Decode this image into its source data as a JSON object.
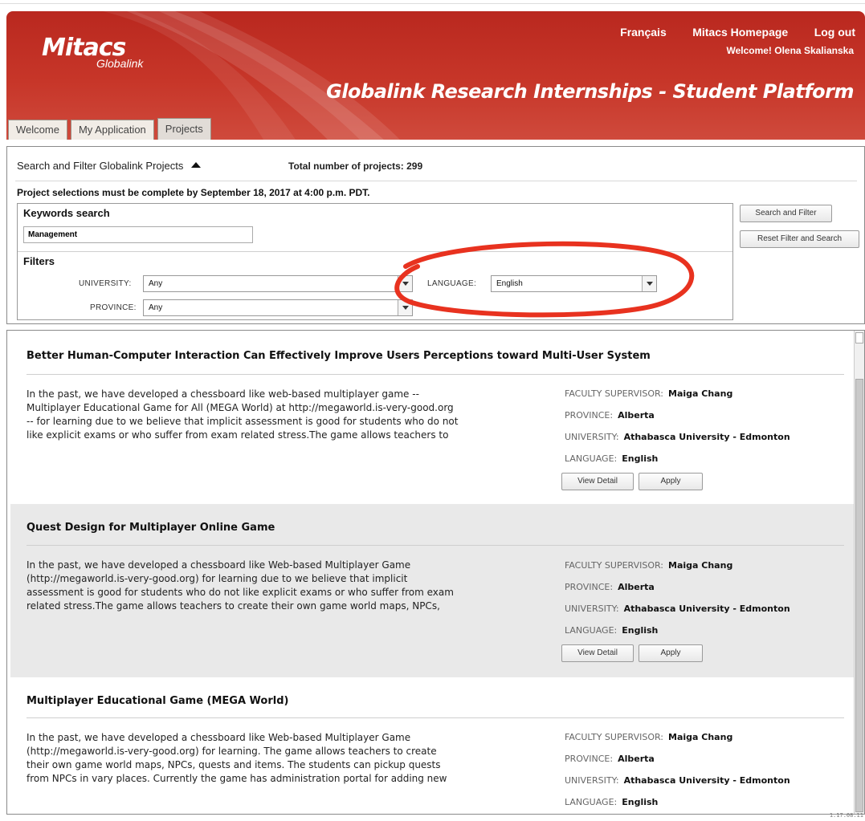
{
  "header": {
    "logo_main": "Mitacs",
    "logo_sub": "Globalink",
    "links": [
      "Français",
      "Mitacs Homepage",
      "Log out"
    ],
    "welcome": "Welcome! Olena Skalianska",
    "platform_title": "Globalink Research Internships - Student Platform",
    "tabs": [
      "Welcome",
      "My Application",
      "Projects"
    ],
    "active_tab": "Projects",
    "brand_color": "#c0302a"
  },
  "search": {
    "heading": "Search and Filter Globalink Projects",
    "total": "Total number of projects: 299",
    "deadline": "Project selections must be complete by September 18, 2017 at 4:00 p.m. PDT.",
    "keywords_label": "Keywords search",
    "keywords_value": "Management",
    "filters_label": "Filters",
    "university_label": "UNIVERSITY:",
    "university_value": "Any",
    "province_label": "PROVINCE:",
    "province_value": "Any",
    "language_label": "LANGUAGE:",
    "language_value": "English",
    "search_button": "Search and Filter",
    "reset_button": "Reset Filter and Search"
  },
  "projects": [
    {
      "title": "Better Human-Computer Interaction Can Effectively Improve Users Perceptions toward Multi-User System",
      "desc": [
        "In the past, we have developed a chessboard like web-based multiplayer game --",
        "Multiplayer Educational Game for All (MEGA World) at http://megaworld.is-very-good.org",
        "-- for learning due to we believe that implicit assessment is good for students who do not",
        "like explicit exams or who suffer from exam related stress.The game allows teachers to"
      ],
      "supervisor_label": "FACULTY SUPERVISOR:",
      "supervisor": "Maiga Chang",
      "province_label": "PROVINCE:",
      "province": "Alberta",
      "university_label": "UNIVERSITY:",
      "university": "Athabasca University - Edmonton",
      "language_label": "LANGUAGE:",
      "language": "English",
      "view_label": "View Detail",
      "apply_label": "Apply"
    },
    {
      "title": "Quest Design for Multiplayer Online Game",
      "desc": [
        "In the past, we have developed a chessboard like Web-based Multiplayer Game",
        "(http://megaworld.is-very-good.org) for learning due to we believe that implicit",
        "assessment is good for students who do not like explicit exams or who suffer from exam",
        "related stress.The game allows teachers to create their own game world maps, NPCs,"
      ],
      "supervisor_label": "FACULTY SUPERVISOR:",
      "supervisor": "Maiga Chang",
      "province_label": "PROVINCE:",
      "province": "Alberta",
      "university_label": "UNIVERSITY:",
      "university": "Athabasca University - Edmonton",
      "language_label": "LANGUAGE:",
      "language": "English",
      "view_label": "View Detail",
      "apply_label": "Apply"
    },
    {
      "title": "Multiplayer Educational Game (MEGA World)",
      "desc": [
        "In the past, we have developed a chessboard like Web-based Multiplayer Game",
        "(http://megaworld.is-very-good.org) for learning. The game allows teachers to create",
        "their own game world maps, NPCs, quests and items. The students can pickup quests",
        "from NPCs in vary places. Currently the game has administration portal for adding new"
      ],
      "supervisor_label": "FACULTY SUPERVISOR:",
      "supervisor": "Maiga Chang",
      "province_label": "PROVINCE:",
      "province": "Alberta",
      "university_label": "UNIVERSITY:",
      "university": "Athabasca University - Edmonton",
      "language_label": "LANGUAGE:",
      "language": "English"
    }
  ],
  "footer": {
    "version": "1.17.08.11"
  },
  "annotation_color": "#e8321f"
}
